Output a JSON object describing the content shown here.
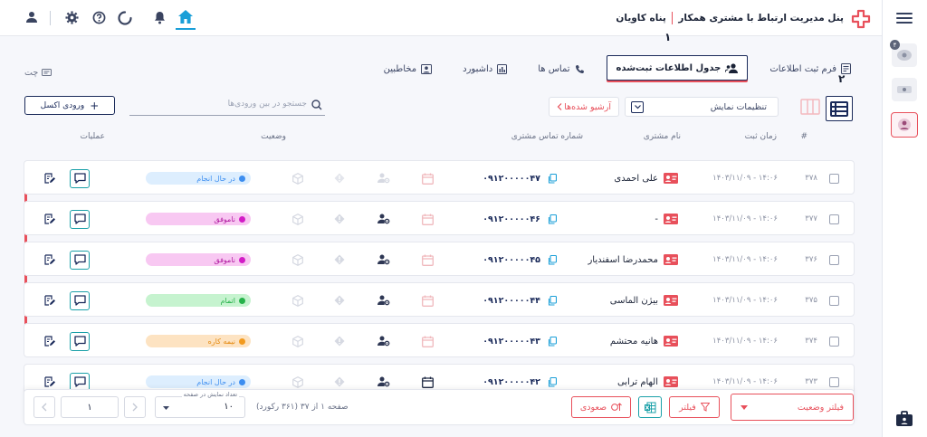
{
  "app": {
    "title": "پنل مدیریت ارتباط با مشتری همکار",
    "company": "پناه کاویان"
  },
  "chat_label": "چت",
  "tabs": [
    {
      "label": "فرم ثبت اطلاعات",
      "icon": "form-icon"
    },
    {
      "label": "جدول اطلاعات ثبت‌شده",
      "icon": "users-icon",
      "active": true
    },
    {
      "label": "تماس ها",
      "icon": "phone-icon"
    },
    {
      "label": "داشبورد",
      "icon": "chart-icon"
    },
    {
      "label": "مخاطبین",
      "icon": "contact-icon"
    }
  ],
  "annotations": {
    "one": "۱",
    "two": "۲"
  },
  "toolbar": {
    "display_settings": "تنظیمات نمایش",
    "archive": "آرشیو شده‌ها",
    "search_placeholder": "جستجو در بین ورودی‌ها",
    "excel_button": "ورودی اکسل"
  },
  "columns": {
    "index": "#",
    "time": "زمان ثبت",
    "name": "نام مشتری",
    "phone": "شماره تماس مشتری",
    "status": "وضعیت",
    "actions": "عملیات"
  },
  "rows": [
    {
      "id": "۳۷۸",
      "time": "۱۴۰۳/۱۱/۰۹ - ۱۴:۰۶",
      "name": "علی احمدی",
      "phone": "۰۹۱۲۰۰۰۰۰۴۷",
      "status": "در حال انجام",
      "status_bg": "#ddeefe",
      "status_dot": "#3d8ef0",
      "status_fg": "#3d8ef0",
      "icons_faded": true,
      "calendar_dark": false
    },
    {
      "id": "۳۷۷",
      "time": "۱۴۰۳/۱۱/۰۹ - ۱۴:۰۶",
      "name": "-",
      "phone": "۰۹۱۲۰۰۰۰۰۴۶",
      "status": "ناموفق",
      "status_bg": "#f8c8f2",
      "status_dot": "#d21cc6",
      "status_fg": "#b0189f",
      "icons_faded": false,
      "calendar_dark": false
    },
    {
      "id": "۳۷۶",
      "time": "۱۴۰۳/۱۱/۰۹ - ۱۴:۰۶",
      "name": "محمدرضا اسفندیار",
      "phone": "۰۹۱۲۰۰۰۰۰۴۵",
      "status": "ناموفق",
      "status_bg": "#f8c8f2",
      "status_dot": "#d21cc6",
      "status_fg": "#b0189f",
      "icons_faded": false,
      "calendar_dark": false
    },
    {
      "id": "۳۷۵",
      "time": "۱۴۰۳/۱۱/۰۹ - ۱۴:۰۶",
      "name": "بیژن الماسی",
      "phone": "۰۹۱۲۰۰۰۰۰۴۴",
      "status": "اتمام",
      "status_bg": "#c6f3cf",
      "status_dot": "#26b24a",
      "status_fg": "#26b24a",
      "icons_faded": false,
      "calendar_dark": false
    },
    {
      "id": "۳۷۴",
      "time": "۱۴۰۳/۱۱/۰۹ - ۱۴:۰۶",
      "name": "هانیه محتشم",
      "phone": "۰۹۱۲۰۰۰۰۰۴۳",
      "status": "نیمه کاره",
      "status_bg": "#fde3c2",
      "status_dot": "#f29a1e",
      "status_fg": "#e48a10",
      "icons_faded": false,
      "calendar_dark": false
    },
    {
      "id": "۳۷۳",
      "time": "۱۴۰۳/۱۱/۰۹ - ۱۴:۰۶",
      "name": "الهام ترابی",
      "phone": "۰۹۱۲۰۰۰۰۰۴۲",
      "status": "در حال انجام",
      "status_bg": "#ddeefe",
      "status_dot": "#3d8ef0",
      "status_fg": "#3d8ef0",
      "icons_faded": false,
      "calendar_dark": true
    }
  ],
  "footer": {
    "status_filter": "فیلتر وضعیت",
    "filter": "فیلتر",
    "sort": "صعودی",
    "page_info": "صفحه ۱ از ۳۷ (۳۶۱ رکورد)",
    "per_page_label": "تعداد نمایش در صفحه",
    "per_page": "۱۰",
    "page_number": "۱"
  },
  "side": {
    "badge": "۴"
  },
  "colors": {
    "accent": "#e8505b",
    "primary": "#1a2a5a",
    "teal": "#1aa0a8",
    "home": "#1a9fd8"
  }
}
